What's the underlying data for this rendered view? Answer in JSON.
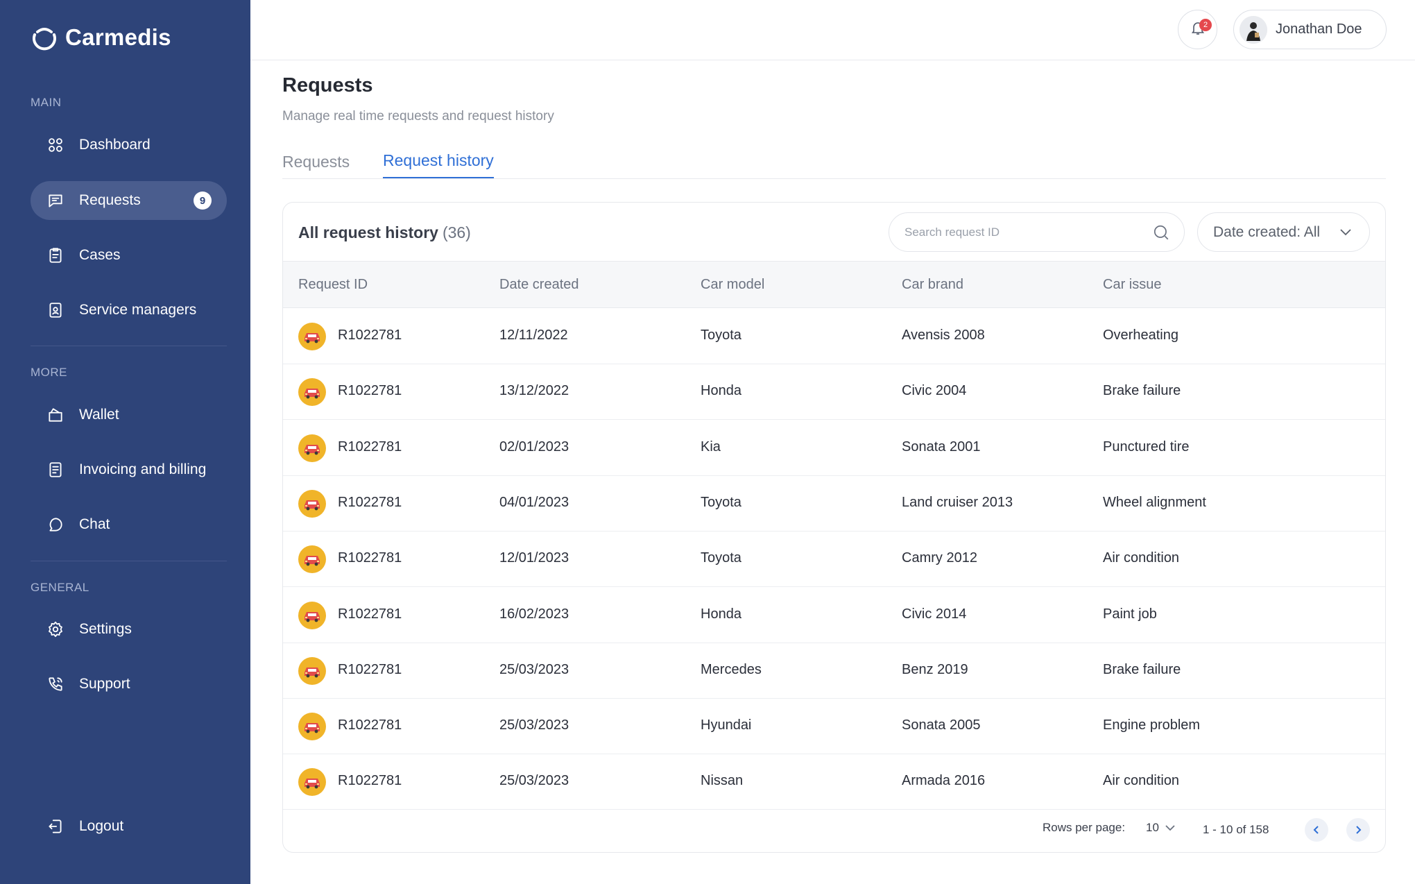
{
  "app": {
    "name": "Carmedis"
  },
  "sidebar": {
    "sections": [
      {
        "label": "MAIN"
      },
      {
        "label": "MORE"
      },
      {
        "label": "GENERAL"
      }
    ],
    "items": [
      {
        "label": "Dashboard",
        "icon": "dashboard-icon"
      },
      {
        "label": "Requests",
        "icon": "chat-square-icon",
        "badge": "9",
        "active": true
      },
      {
        "label": "Cases",
        "icon": "clipboard-icon"
      },
      {
        "label": "Service managers",
        "icon": "id-badge-icon"
      },
      {
        "label": "Wallet",
        "icon": "wallet-icon"
      },
      {
        "label": "Invoicing and billing",
        "icon": "invoice-icon"
      },
      {
        "label": "Chat",
        "icon": "chat-bubble-icon"
      },
      {
        "label": "Settings",
        "icon": "gear-icon"
      },
      {
        "label": "Support",
        "icon": "phone-icon"
      },
      {
        "label": "Logout",
        "icon": "logout-icon"
      }
    ]
  },
  "topbar": {
    "notifications": "2",
    "user_name": "Jonathan Doe"
  },
  "page": {
    "title": "Requests",
    "subtitle": "Manage real time requests and request history",
    "tabs": [
      {
        "label": "Requests",
        "active": false
      },
      {
        "label": "Request history",
        "active": true
      }
    ]
  },
  "card": {
    "title": "All request history",
    "count": "(36)",
    "search_placeholder": "Search request ID",
    "date_filter": "Date created: All"
  },
  "table": {
    "headers": [
      "Request ID",
      "Date created",
      "Car model",
      "Car brand",
      "Car issue"
    ],
    "rows": [
      [
        "R1022781",
        "12/11/2022",
        "Toyota",
        "Avensis 2008",
        "Overheating"
      ],
      [
        "R1022781",
        "13/12/2022",
        "Honda",
        "Civic 2004",
        "Brake failure"
      ],
      [
        "R1022781",
        "02/01/2023",
        "Kia",
        "Sonata 2001",
        "Punctured tire"
      ],
      [
        "R1022781",
        "04/01/2023",
        "Toyota",
        "Land cruiser 2013",
        "Wheel alignment"
      ],
      [
        "R1022781",
        "12/01/2023",
        "Toyota",
        "Camry 2012",
        "Air condition"
      ],
      [
        "R1022781",
        "16/02/2023",
        "Honda",
        "Civic 2014",
        "Paint job"
      ],
      [
        "R1022781",
        "25/03/2023",
        "Mercedes",
        "Benz 2019",
        "Brake failure"
      ],
      [
        "R1022781",
        "25/03/2023",
        "Hyundai",
        "Sonata 2005",
        "Engine problem"
      ],
      [
        "R1022781",
        "25/03/2023",
        "Nissan",
        "Armada 2016",
        "Air condition"
      ]
    ]
  },
  "pagination": {
    "rows_per_page_label": "Rows per page:",
    "rows_per_page": "10",
    "range": "1 - 10 of 158"
  },
  "colors": {
    "sidebar_bg": "#2e4479",
    "accent": "#2f6fd6",
    "car_icon_bg": "#f0b429",
    "badge_red": "#e5484d"
  }
}
